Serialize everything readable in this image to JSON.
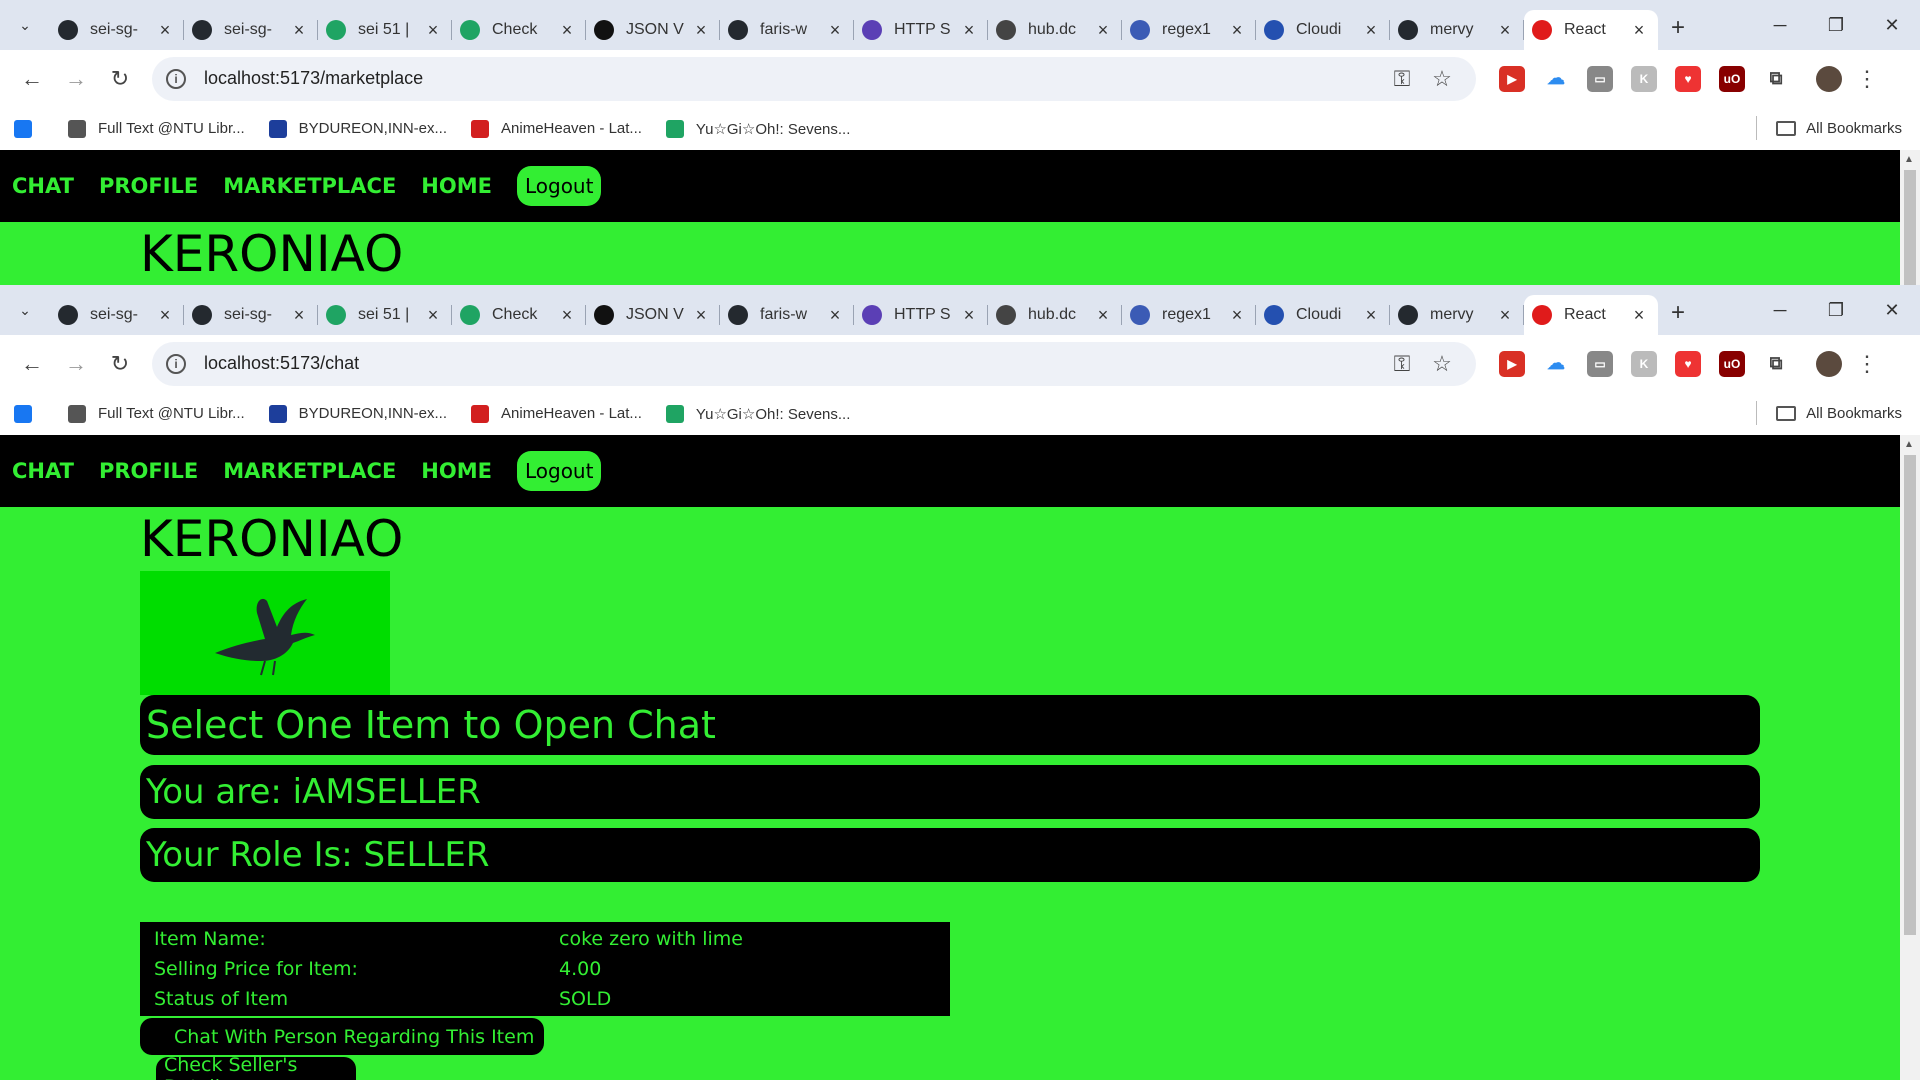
{
  "tabs": [
    {
      "label": "sei-sg-",
      "icon": "github-icon",
      "color": "#24292f"
    },
    {
      "label": "sei-sg-",
      "icon": "github-icon",
      "color": "#24292f"
    },
    {
      "label": "sei 51 |",
      "icon": "sheets-icon",
      "color": "#1fa463"
    },
    {
      "label": "Check",
      "icon": "sheets-icon",
      "color": "#1fa463"
    },
    {
      "label": "JSON V",
      "icon": "json-icon",
      "color": "#111111"
    },
    {
      "label": "faris-w",
      "icon": "github-icon",
      "color": "#24292f"
    },
    {
      "label": "HTTP S",
      "icon": "http-icon",
      "color": "#5b3fb5"
    },
    {
      "label": "hub.dc",
      "icon": "hub-icon",
      "color": "#444444"
    },
    {
      "label": "regex1",
      "icon": "regex-icon",
      "color": "#3b5bb5"
    },
    {
      "label": "Cloudi",
      "icon": "cloud-icon",
      "color": "#2450b0"
    },
    {
      "label": "mervy",
      "icon": "github-icon",
      "color": "#24292f"
    },
    {
      "label": "React",
      "icon": "react-ga-icon",
      "color": "#e01b1b",
      "active": true
    }
  ],
  "window1": {
    "url": "localhost:5173/marketplace"
  },
  "window2": {
    "url": "localhost:5173/chat"
  },
  "bookmarks": [
    {
      "label": "",
      "icon": "facebook-icon",
      "color": "#1877f2"
    },
    {
      "label": "Full Text @NTU Libr...",
      "icon": "globe-icon",
      "color": "#555555"
    },
    {
      "label": "BYDUREON,INN-ex...",
      "icon": "eu-flag-icon",
      "color": "#1d3e9b"
    },
    {
      "label": "AnimeHeaven - Lat...",
      "icon": "animeheaven-icon",
      "color": "#d21f1f"
    },
    {
      "label": "Yu☆Gi☆Oh!: Sevens...",
      "icon": "yugioh-icon",
      "color": "#1fa463"
    }
  ],
  "all_bookmarks_label": "All Bookmarks",
  "app": {
    "nav": [
      "CHAT",
      "PROFILE",
      "MARKETPLACE",
      "HOME"
    ],
    "logout_label": "Logout",
    "brand": "KERONIAO",
    "select_heading": "Select One Item to Open Chat",
    "you_are": "You are: iAMSELLER",
    "role": "Your Role Is: SELLER",
    "item": {
      "name_label": "Item Name:",
      "name_value": "coke zero with lime",
      "price_label": "Selling Price for Item:",
      "price_value": "4.00",
      "status_label": "Status of Item",
      "status_value": "SOLD"
    },
    "chat_button": "Chat With Person Regarding This Item",
    "seller_button": "Check Seller's Details"
  },
  "colors": {
    "accent": "#33ee33",
    "nav_bg": "#000000"
  }
}
